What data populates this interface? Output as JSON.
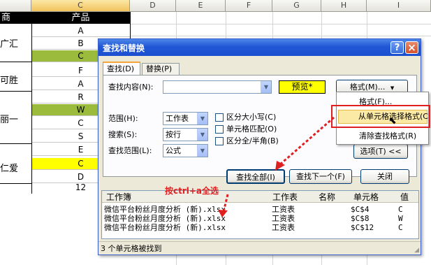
{
  "sheet": {
    "columns": [
      "C",
      "D",
      "E",
      "F",
      "G",
      "H",
      "I"
    ],
    "header_cell": "产品",
    "left_header": "商",
    "products": [
      "A",
      "B",
      "C",
      "F",
      "A",
      "R",
      "W",
      "C",
      "S",
      "E",
      "C",
      "D",
      "12"
    ],
    "merchants": [
      "广汇",
      "可胜",
      "丽一",
      "仁爱"
    ]
  },
  "dialog": {
    "title": "查找和替换",
    "help": "?",
    "close": "×",
    "tab_find": "查找(D)",
    "tab_replace": "替换(P)",
    "find_label": "查找内容(N):",
    "find_value": "",
    "preview": "预览*",
    "format_btn": "格式(M)...",
    "scope_label": "范围(H):",
    "scope_value": "工作表",
    "search_label": "搜索(S):",
    "search_value": "按行",
    "lookin_label": "查找范围(L):",
    "lookin_value": "公式",
    "cb_case": "区分大小写(C)",
    "cb_whole": "单元格匹配(O)",
    "cb_width": "区分全/半角(B)",
    "options_btn": "选项(T) <<",
    "find_all": "查找全部(I)",
    "find_next": "查找下一个(F)",
    "close_btn": "关闭",
    "results_headers": [
      "工作簿",
      "工作表",
      "名称",
      "单元格",
      "值"
    ],
    "results": [
      {
        "book": "微信平台粉丝月度分析 (新).xlsx",
        "sheet": "工资表",
        "name": "",
        "cell": "$C$4",
        "value": "C"
      },
      {
        "book": "微信平台粉丝月度分析 (新).xlsx",
        "sheet": "工资表",
        "name": "",
        "cell": "$C$8",
        "value": "W"
      },
      {
        "book": "微信平台粉丝月度分析 (新).xlsx",
        "sheet": "工资表",
        "name": "",
        "cell": "$C$12",
        "value": "C"
      }
    ],
    "status": "3 个单元格被找到"
  },
  "menu": {
    "items": [
      "格式(F)...",
      "从单元格选择格式(C",
      "清除查找格式(R)"
    ]
  },
  "annotation": {
    "text": "按ctrl+a全选"
  },
  "colors": {
    "accent": "#1b4fcf",
    "highlight_green": "#9bbb3c",
    "highlight_yellow": "#ffff00",
    "annotation_red": "#e02020"
  }
}
